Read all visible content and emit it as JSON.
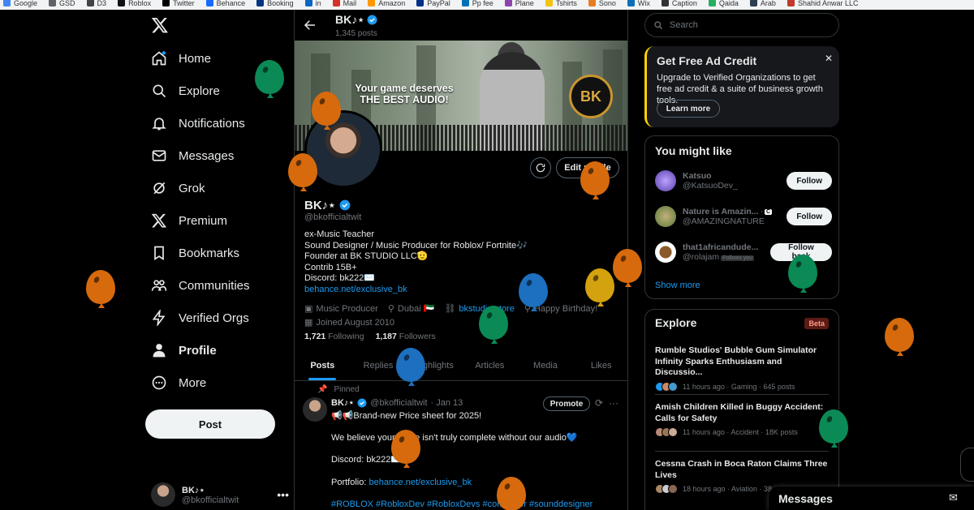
{
  "bookmarks": [
    "Google",
    "GSD",
    "D3",
    "Roblox",
    "Twitter",
    "Behance",
    "Booking",
    "in",
    "Mail",
    "Amazon",
    "PayPal",
    "Pp fee",
    "Plane",
    "Tshirts",
    "Sono",
    "Wix",
    "Caption",
    "Qaida",
    "Arab",
    "Shahid Anwar LLC"
  ],
  "nav": {
    "items": [
      {
        "label": "Home"
      },
      {
        "label": "Explore"
      },
      {
        "label": "Notifications"
      },
      {
        "label": "Messages"
      },
      {
        "label": "Grok"
      },
      {
        "label": "Premium"
      },
      {
        "label": "Bookmarks"
      },
      {
        "label": "Communities"
      },
      {
        "label": "Verified Orgs"
      },
      {
        "label": "Profile"
      },
      {
        "label": "More"
      }
    ],
    "post_label": "Post",
    "account": {
      "name": "BK♪⋆",
      "handle": "@bkofficialtwit"
    }
  },
  "profile": {
    "top_name": "BK♪⋆",
    "posts_count": "1,345 posts",
    "banner_text_line1": "Your game deserves",
    "banner_text_line2": "THE BEST AUDIO!",
    "banner_logo": "BK",
    "edit_label": "Edit profile",
    "name": "BK♪⋆",
    "handle": "@bkofficialtwit",
    "bio": [
      "ex-Music Teacher",
      "Sound Designer / Music Producer for Roblox/ Fortnite🎶",
      "Founder at BK STUDIO LLC🫡",
      "Contrib 15B+",
      "Discord: bk222✉️"
    ],
    "bio_link": "behance.net/exclusive_bk",
    "category": "Music Producer",
    "location": "Dubai 🇦🇪",
    "website": "bkstudio.store",
    "birthday": "Happy Birthday!",
    "joined": "Joined August 2010",
    "following_count": "1,721",
    "following_label": "Following",
    "followers_count": "1,187",
    "followers_label": "Followers"
  },
  "tabs": [
    "Posts",
    "Replies",
    "Highlights",
    "Articles",
    "Media",
    "Likes"
  ],
  "tweet": {
    "pinned_label": "Pinned",
    "name": "BK♪⋆",
    "handle": "@bkofficialtwit",
    "date": "· Jan 13",
    "promote_label": "Promote",
    "line1": "📢📢Brand-new Price sheet for 2025!",
    "line2": "We believe your game isn't truly complete without our audio💙",
    "line3": "Discord: bk222✉️",
    "portfolio_label": "Portfolio:",
    "portfolio_link": "behance.net/exclusive_bk",
    "hashtags": "#ROBLOX #RobloxDev #RobloxDevs #composer #sounddesigner"
  },
  "right": {
    "search_placeholder": "Search",
    "ad": {
      "title": "Get Free Ad Credit",
      "body": "Upgrade to Verified Organizations to get free ad credit & a suite of business growth tools.",
      "cta": "Learn more"
    },
    "wtf": {
      "title": "You might like",
      "users": [
        {
          "name": "Katsuo",
          "handle": "@KatsuoDev_",
          "action": "Follow",
          "follows_you": ""
        },
        {
          "name": "Nature is Amazin...",
          "handle": "@AMAZINGNATURE",
          "action": "Follow",
          "follows_you": ""
        },
        {
          "name": "that1africandude...",
          "handle": "@rolajam",
          "action": "Follow back",
          "follows_you": "Follows you"
        }
      ],
      "show_more": "Show more"
    },
    "explore": {
      "title": "Explore",
      "badge": "Beta",
      "news": [
        {
          "headline": "Rumble Studios' Bubble Gum Simulator Infinity Sparks Enthusiasm and Discussio...",
          "meta": "11 hours ago · Gaming · 645 posts"
        },
        {
          "headline": "Amish Children Killed in Buggy Accident: Calls for Safety",
          "meta": "11 hours ago · Accident · 18K posts"
        },
        {
          "headline": "Cessna Crash in Boca Raton Claims Three Lives",
          "meta": "18 hours ago · Aviation · 38"
        }
      ]
    },
    "messages_label": "Messages"
  },
  "colors": {
    "accent": "#1d9bf0",
    "background": "#000000",
    "border": "#2f3336",
    "muted": "#71767b"
  }
}
